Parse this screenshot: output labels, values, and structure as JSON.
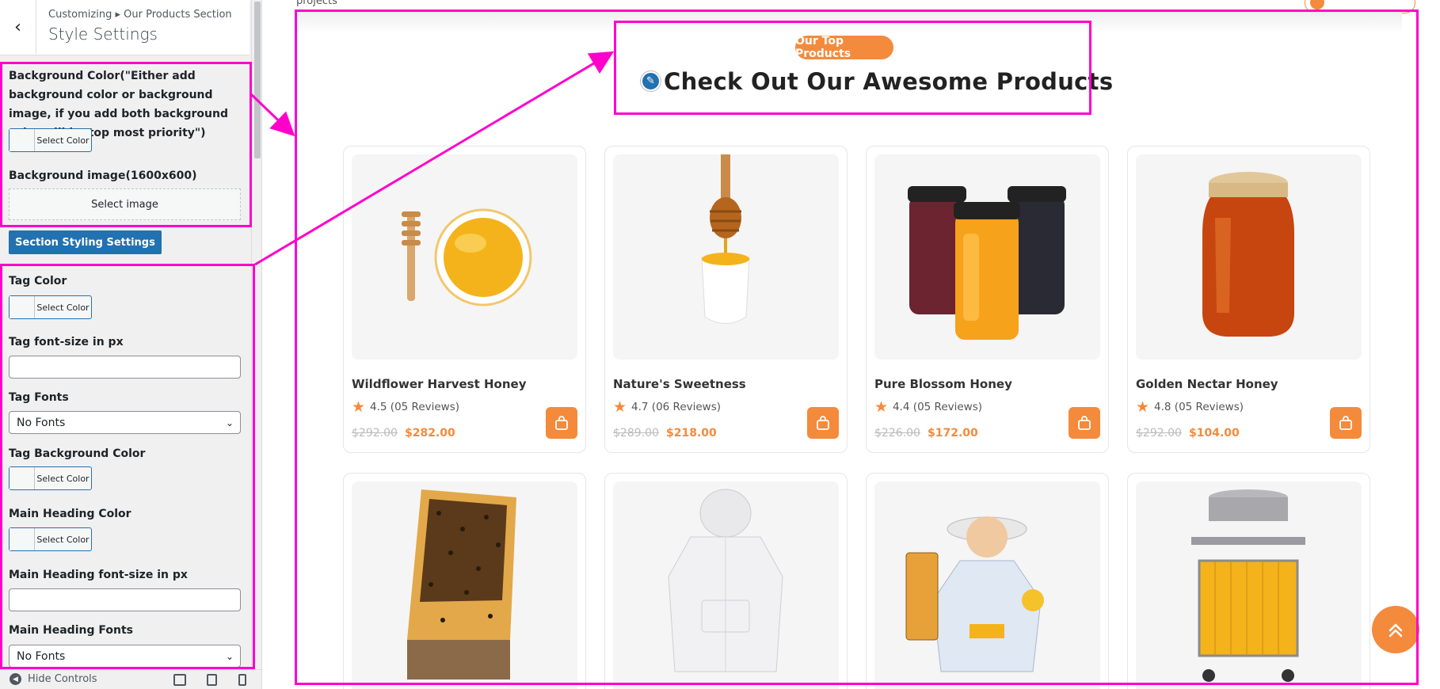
{
  "sidebar": {
    "breadcrumb": "Customizing ▸ Our Products Section",
    "title": "Style Settings",
    "bg_color_label": "Background Color(\"Either add background color or background image, if you add both background color will be top most priority\")",
    "select_color": "Select Color",
    "bg_image_label": "Background image(1600x600)",
    "select_image": "Select image",
    "section_styling_button": "Section Styling Settings",
    "tag_color_label": "Tag Color",
    "tag_font_size_label": "Tag font-size in px",
    "tag_fonts_label": "Tag Fonts",
    "tag_fonts_value": "No Fonts",
    "tag_bg_color_label": "Tag Background Color",
    "heading_color_label": "Main Heading Color",
    "heading_font_size_label": "Main Heading font-size in px",
    "heading_fonts_label": "Main Heading Fonts",
    "heading_fonts_value": "No Fonts",
    "hide_controls": "Hide Controls"
  },
  "preview": {
    "top_text": "projects",
    "tag": "Our Top Products",
    "heading": "Check Out Our Awesome Products",
    "accent_color": "#f48a3c",
    "products": [
      {
        "name": "Wildflower Harvest Honey",
        "rating": "4.5 (05 Reviews)",
        "old_price": "$292.00",
        "new_price": "$282.00",
        "image": "honey-bowl-dipper"
      },
      {
        "name": "Nature's Sweetness",
        "rating": "4.7 (06 Reviews)",
        "old_price": "$289.00",
        "new_price": "$218.00",
        "image": "honey-dipper-cup"
      },
      {
        "name": "Pure Blossom Honey",
        "rating": "4.4 (05 Reviews)",
        "old_price": "$226.00",
        "new_price": "$172.00",
        "image": "three-jars"
      },
      {
        "name": "Golden Nectar Honey",
        "rating": "4.8 (05 Reviews)",
        "old_price": "$292.00",
        "new_price": "$104.00",
        "image": "honey-jar"
      },
      {
        "name": "",
        "rating": "",
        "old_price": "",
        "new_price": "",
        "image": "bee-frame"
      },
      {
        "name": "",
        "rating": "",
        "old_price": "",
        "new_price": "",
        "image": "bee-jacket"
      },
      {
        "name": "",
        "rating": "",
        "old_price": "",
        "new_price": "",
        "image": "beekeeper"
      },
      {
        "name": "",
        "rating": "",
        "old_price": "",
        "new_price": "",
        "image": "honey-extractor"
      }
    ]
  }
}
